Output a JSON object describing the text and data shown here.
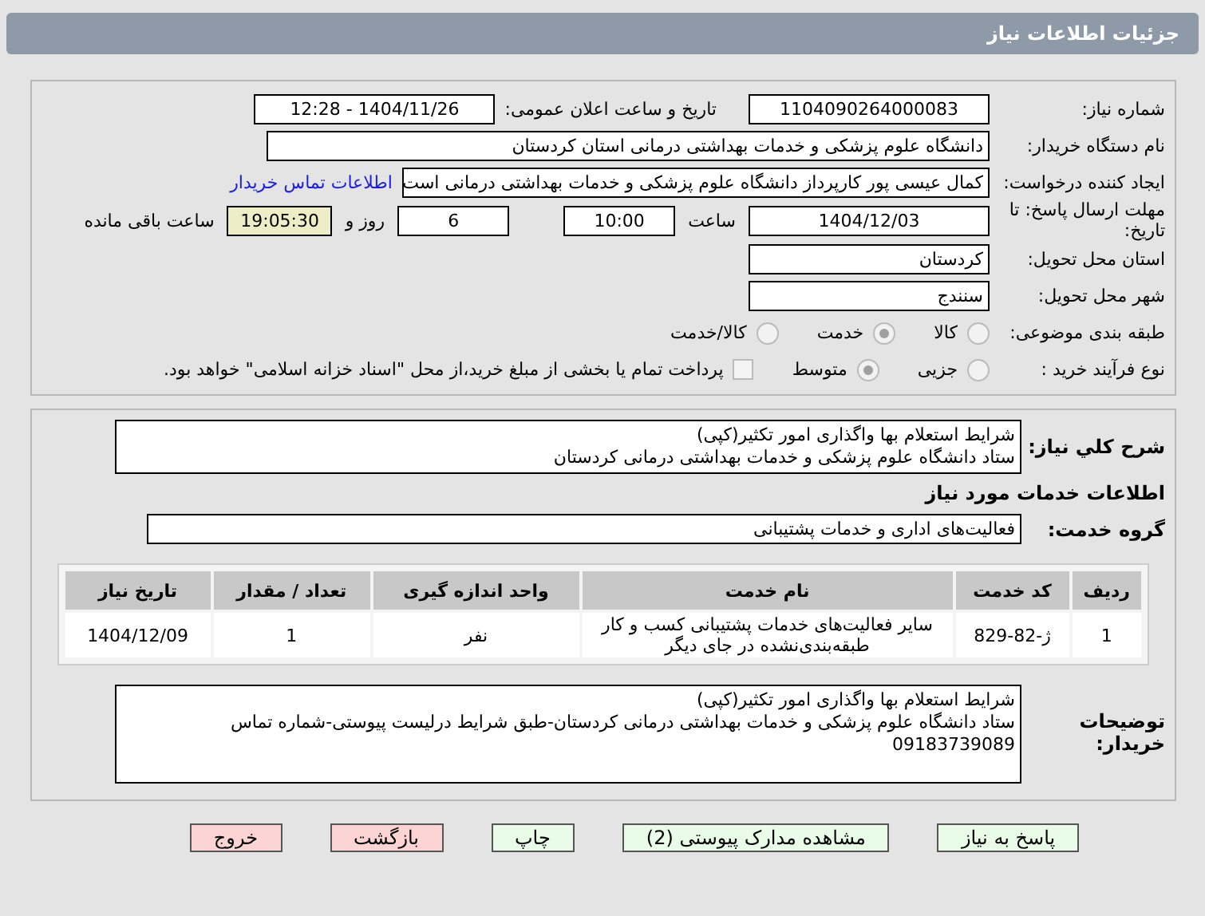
{
  "header": {
    "title": "جزئیات اطلاعات نیاز"
  },
  "fields": {
    "need_number": {
      "label": "شماره نیاز:",
      "value": "1104090264000083"
    },
    "announce": {
      "label": "تاریخ و ساعت اعلان عمومی:",
      "value": "1404/11/26 - 12:28"
    },
    "buyer": {
      "label": "نام دستگاه خریدار:",
      "value": "دانشگاه علوم پزشکی و خدمات بهداشتی  درمانی استان کردستان"
    },
    "creator": {
      "label": "ایجاد کننده درخواست:",
      "value": "کمال عیسی پور کارپرداز دانشگاه علوم پزشکی و خدمات بهداشتی  درمانی است",
      "link": "اطلاعات تماس خریدار"
    },
    "deadline": {
      "label": "مهلت ارسال پاسخ: تا تاریخ:",
      "date": "1404/12/03",
      "time_label": "ساعت",
      "time": "10:00",
      "days": "6",
      "days_label": "روز و",
      "remaining": "19:05:30",
      "remaining_label": "ساعت باقی مانده"
    },
    "province": {
      "label": "استان محل تحویل:",
      "value": "کردستان"
    },
    "city": {
      "label": "شهر محل تحویل:",
      "value": "سنندج"
    }
  },
  "category": {
    "label": "طبقه بندی موضوعی:",
    "options": [
      {
        "label": "کالا",
        "selected": false
      },
      {
        "label": "خدمت",
        "selected": true
      },
      {
        "label": "کالا/خدمت",
        "selected": false
      }
    ]
  },
  "process": {
    "label": "نوع فرآیند خرید :",
    "options": [
      {
        "label": "جزیی",
        "selected": false
      },
      {
        "label": "متوسط",
        "selected": true
      }
    ],
    "treasury": {
      "checked": false,
      "text": "پرداخت تمام یا بخشی از مبلغ خرید،از محل \"اسناد خزانه اسلامی\" خواهد بود."
    }
  },
  "summary": {
    "label": "شرح كلي نياز:",
    "lines": [
      "شرایط استعلام بها واگذاری امور تکثیر(کپی)",
      "ستاد دانشگاه علوم پزشکی و خدمات بهداشتی درمانی کردستان"
    ]
  },
  "services_title": "اطلاعات خدمات مورد نیاز",
  "service_group": {
    "label": "گروه خدمت:",
    "value": "فعالیت‌های اداری و خدمات پشتیبانی"
  },
  "table": {
    "columns": [
      "ردیف",
      "کد خدمت",
      "نام خدمت",
      "واحد اندازه گیری",
      "تعداد / مقدار",
      "تاریخ نیاز"
    ],
    "rows": [
      [
        "1",
        "ژ-82-829",
        "سایر فعالیت‌های خدمات پشتیبانی کسب و کار طبقه‌بندی‌نشده در جای دیگر",
        "نفر",
        "1",
        "1404/12/09"
      ]
    ]
  },
  "buyer_notes": {
    "label": "توضیحات خریدار:",
    "lines": [
      "شرایط استعلام بها واگذاری امور تکثیر(کپی)",
      "ستاد دانشگاه علوم پزشکی و خدمات بهداشتی درمانی کردستان-طبق شرایط درلیست پیوستی-شماره تماس",
      "09183739089"
    ]
  },
  "buttons": [
    {
      "label": "پاسخ به نیاز",
      "kind": "action"
    },
    {
      "label": "مشاهده مدارک پیوستی (2)",
      "kind": "action"
    },
    {
      "label": "چاپ",
      "kind": "action"
    },
    {
      "label": "بازگشت",
      "kind": "exit"
    },
    {
      "label": "خروج",
      "kind": "exit"
    }
  ]
}
